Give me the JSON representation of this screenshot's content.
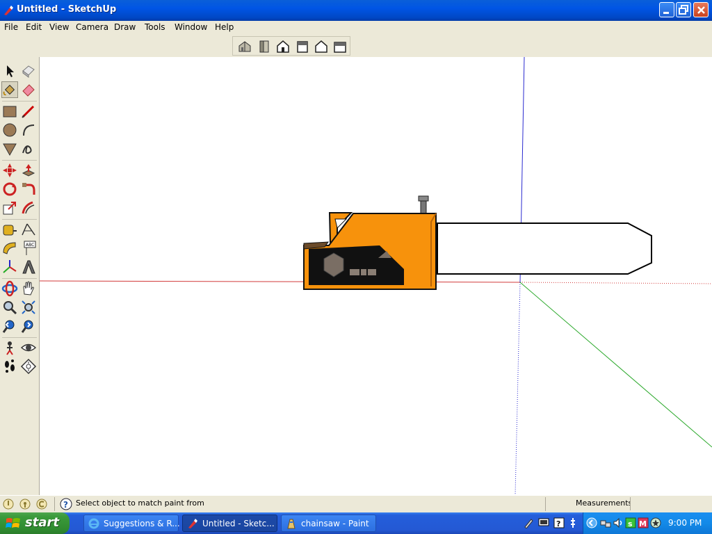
{
  "window": {
    "title": "Untitled - SketchUp"
  },
  "menu": [
    "File",
    "Edit",
    "View",
    "Camera",
    "Draw",
    "Tools",
    "Window",
    "Help"
  ],
  "views_toolbar": [
    "iso-view-icon",
    "top-view-icon",
    "front-view-icon",
    "right-view-icon",
    "back-view-icon",
    "left-view-icon"
  ],
  "tools": [
    "select-icon",
    "make-component-icon",
    "paint-bucket-icon",
    "eraser-icon",
    "rectangle-icon",
    "line-icon",
    "circle-icon",
    "arc-icon",
    "polygon-icon",
    "freehand-icon",
    "move-icon",
    "push-pull-icon",
    "rotate-icon",
    "follow-me-icon",
    "scale-icon",
    "offset-icon",
    "tape-measure-icon",
    "dimension-icon",
    "protractor-icon",
    "text-icon",
    "axes-icon",
    "3d-text-icon",
    "orbit-icon",
    "pan-icon",
    "zoom-icon",
    "zoom-window-icon",
    "previous-view-icon",
    "next-view-icon",
    "position-camera-icon",
    "look-around-icon",
    "walk-icon",
    "section-plane-icon"
  ],
  "selected_tool": "paint-bucket-icon",
  "status": {
    "message": "Select object to match paint from",
    "measurements_label": "Measurements",
    "measurements_value": ""
  },
  "taskbar": {
    "start_label": "start",
    "tasks": [
      {
        "label": "Suggestions & R...",
        "icon": "ie-icon",
        "active": false
      },
      {
        "label": "Untitled - Sketc...",
        "icon": "sketchup-icon",
        "active": true
      },
      {
        "label": "chainsaw - Paint",
        "icon": "paint-icon",
        "active": false
      }
    ],
    "clock": "9:00 PM"
  },
  "colors": {
    "chainsaw_body": "#f7920c",
    "red_axis": "#d23a3a",
    "green_axis": "#2aa82a",
    "blue_axis": "#2a2ad0"
  }
}
